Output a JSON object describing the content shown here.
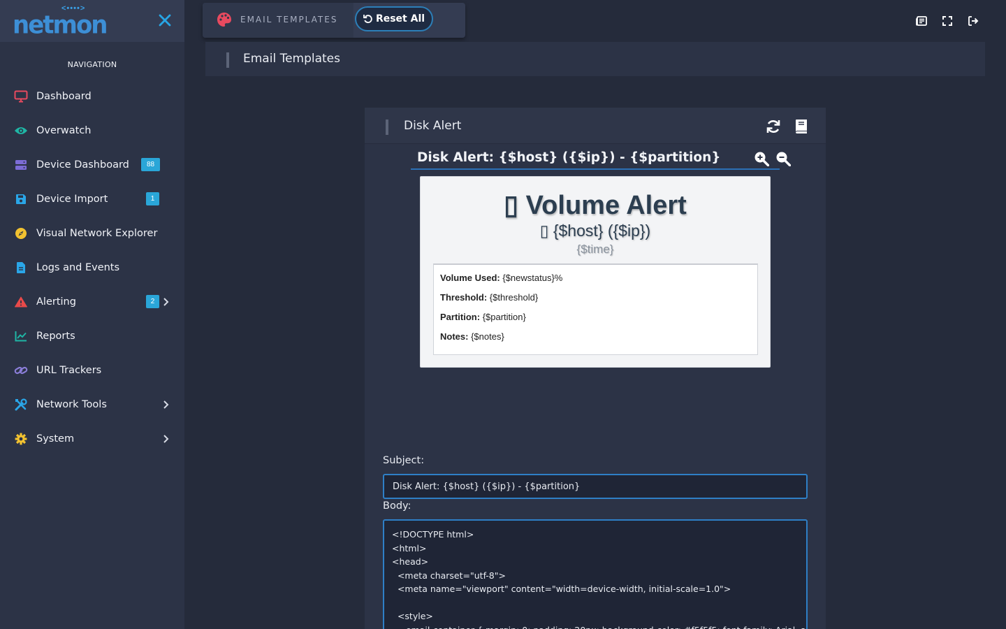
{
  "brand": {
    "logo_text": "netmon",
    "logo_dots": "<••••>"
  },
  "sidebar": {
    "heading": "NAVIGATION",
    "items": [
      {
        "label": "Dashboard",
        "icon": "monitor-icon",
        "color": "#e84a5f"
      },
      {
        "label": "Overwatch",
        "icon": "eye-icon",
        "color": "#1fb6a5"
      },
      {
        "label": "Device Dashboard",
        "icon": "server-icon",
        "color": "#7c6cd6",
        "badge": "88"
      },
      {
        "label": "Device Import",
        "icon": "save-icon",
        "color": "#2aa6e8",
        "badge": "1"
      },
      {
        "label": "Visual Network Explorer",
        "icon": "compass-icon",
        "color": "#f2c230"
      },
      {
        "label": "Logs and Events",
        "icon": "file-icon",
        "color": "#2aa6e8"
      },
      {
        "label": "Alerting",
        "icon": "warning-icon",
        "color": "#e84a4a",
        "badge": "2"
      },
      {
        "label": "Reports",
        "icon": "chart-line-icon",
        "color": "#1fb6a5"
      },
      {
        "label": "URL Trackers",
        "icon": "link-icon",
        "color": "#8b7ed8"
      },
      {
        "label": "Network Tools",
        "icon": "tools-icon",
        "color": "#2aa6e8"
      },
      {
        "label": "System",
        "icon": "gear-icon",
        "color": "#f2c230"
      }
    ]
  },
  "topbar": {
    "section_title": "EMAIL TEMPLATES",
    "reset_label": "Reset All"
  },
  "page": {
    "title": "Email Templates"
  },
  "card": {
    "title": "Disk Alert",
    "preview": {
      "subject": "Disk Alert: {$host} ({$ip}) - {$partition}",
      "heading": "Volume Alert",
      "heading_glyph": "▯",
      "host_line": "{$host} ({$ip})",
      "host_glyph": "▯",
      "time": "{$time}",
      "rows": [
        {
          "label": "Volume Used:",
          "value": "{$newstatus}%"
        },
        {
          "label": "Threshold:",
          "value": "{$threshold}"
        },
        {
          "label": "Partition:",
          "value": "{$partition}"
        },
        {
          "label": "Notes:",
          "value": "{$notes}"
        }
      ]
    },
    "subject_label": "Subject:",
    "subject_value": "Disk Alert: {$host} ({$ip}) - {$partition}",
    "body_label": "Body:",
    "body_value": "<!DOCTYPE html>\n<html>\n<head>\n  <meta charset=\"utf-8\">\n  <meta name=\"viewport\" content=\"width=device-width, initial-scale=1.0\">\n\n  <style>\n    .email-container { margin: 0; padding: 20px; background-color: #f5f5f5; font-family: Arial, sans-"
  }
}
